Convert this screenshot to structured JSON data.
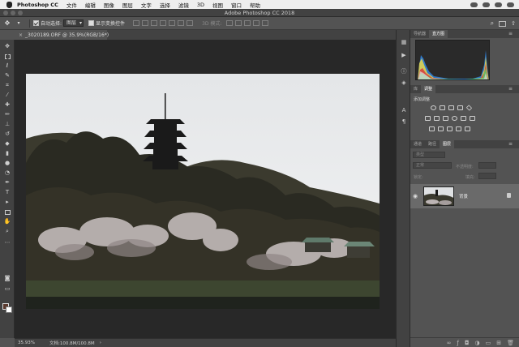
{
  "menubar": {
    "app": "Photoshop CC",
    "items": [
      "文件",
      "编辑",
      "图像",
      "图层",
      "文字",
      "选择",
      "滤镜",
      "3D",
      "视图",
      "窗口",
      "帮助"
    ]
  },
  "window": {
    "title": "Adobe Photoshop CC 2018"
  },
  "options": {
    "auto_select_label": "自动选择:",
    "auto_select_value": "图层",
    "show_transform_label": "显示变换控件",
    "mode3d_label": "3D 模式:"
  },
  "document": {
    "tab_label": "_3020189.ORF @ 35.9%(RGB/16*)",
    "close_symbol": "×"
  },
  "status": {
    "zoom": "35.93%",
    "doc_size": "文档:100.8M/100.8M",
    "arrow": "›"
  },
  "panels": {
    "histogram_tabs": [
      "导航器",
      "直方图"
    ],
    "adjustments_tabs": [
      "库",
      "调整"
    ],
    "adjust_add_label": "添加调整",
    "layers_tabs": [
      "通道",
      "路径",
      "图层"
    ],
    "layer_kind_filter": "类型",
    "blend_mode": "正常",
    "opacity_label": "不透明度:",
    "lock_label": "锁定:",
    "fill_label": "填充:",
    "background_layer_name": "背景"
  },
  "colors": {
    "foreground": "#5b3a2e",
    "background": "#ffffff",
    "ui_dark": "#424242",
    "ui_mid": "#535353",
    "canvas_bg": "#282828"
  },
  "icons": {
    "toolbar": [
      "move-icon",
      "marquee-icon",
      "lasso-icon",
      "quick-select-icon",
      "crop-icon",
      "eyedropper-icon",
      "healing-icon",
      "brush-icon",
      "stamp-icon",
      "history-brush-icon",
      "eraser-icon",
      "gradient-icon",
      "blur-icon",
      "dodge-icon",
      "pen-icon",
      "type-icon",
      "path-select-icon",
      "rectangle-icon",
      "hand-icon",
      "zoom-icon",
      "more-icon"
    ],
    "dock": [
      "histogram-icon",
      "play-icon",
      "info-icon",
      "layers-icon",
      "character-icon",
      "paragraph-icon"
    ]
  }
}
